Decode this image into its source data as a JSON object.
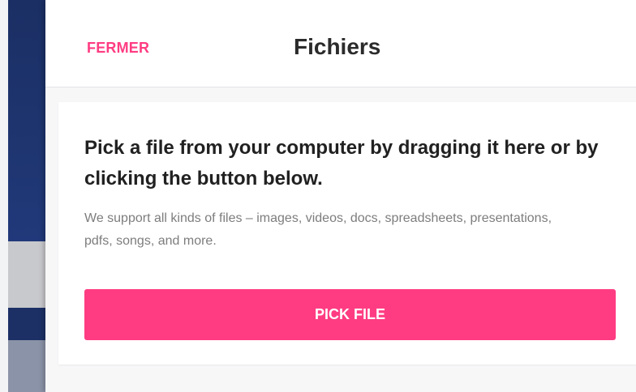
{
  "header": {
    "close_label": "FERMER",
    "title": "Fichiers"
  },
  "picker": {
    "heading": "Pick a file from your computer by dragging it here or by clicking the button below.",
    "description": "We support all kinds of files – images, videos, docs, spreadsheets, presentations, pdfs, songs, and more.",
    "button_label": "PICK FILE"
  },
  "colors": {
    "accent": "#ff3c82",
    "background_app": "#1a2e63"
  }
}
